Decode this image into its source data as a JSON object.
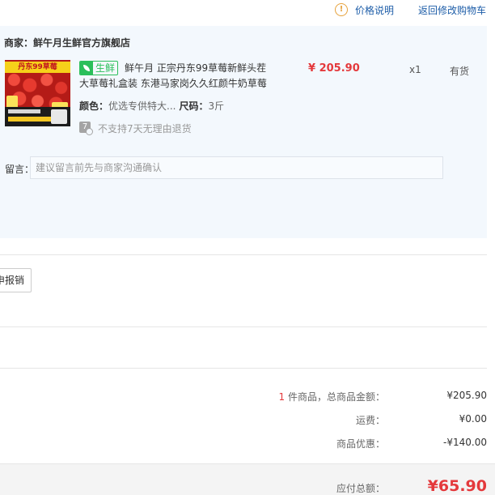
{
  "header": {
    "price_explain": "价格说明",
    "back_to_cart": "返回修改购物车"
  },
  "store": {
    "merchant_label": "商家：鲜午月生鲜官方旗舰店",
    "product": {
      "image_banner": "丹东99草莓",
      "fresh_badge": "生鲜",
      "name": "鲜午月 正宗丹东99草莓新鲜头茬大草莓礼盒装 东港马家岗久久红颜牛奶草莓",
      "price": "¥ 205.90",
      "quantity": "x1",
      "stock": "有货",
      "color_label": "颜色：",
      "color_value": "优选专供特大...",
      "size_label": "尺码：",
      "size_value": "3斤",
      "return_icon": "7",
      "return_policy": "不支持7天无理由退货"
    },
    "note": {
      "label": "留言：",
      "placeholder": "建议留言前先与商家沟通确认",
      "value": ""
    }
  },
  "reimbursement": {
    "button_label": "申报销"
  },
  "summary": {
    "item_count": "1",
    "item_total_label": "件商品，总商品金额：",
    "item_total_value": "¥205.90",
    "shipping_label": "运费：",
    "shipping_value": "¥0.00",
    "discount_label": "商品优惠：",
    "discount_value": "-¥140.00",
    "grand_total_label": "应付总额：",
    "grand_total_value": "¥65.90"
  },
  "colors": {
    "accent_red": "#e4393c",
    "link_blue": "#1d5da8",
    "fresh_green": "#2bbf5a",
    "panel_bg": "#f3f8fd"
  }
}
